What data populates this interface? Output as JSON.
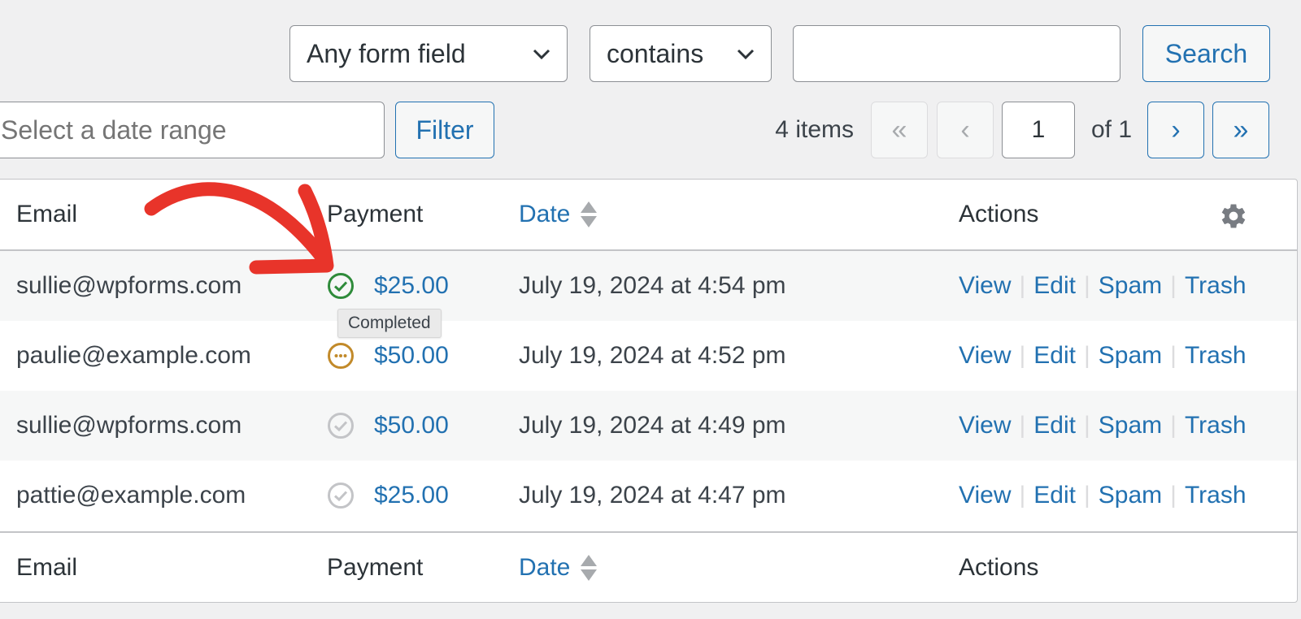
{
  "search": {
    "field_select": "Any form field",
    "operator_select": "contains",
    "query_value": "",
    "search_label": "Search"
  },
  "filter": {
    "date_placeholder": "Select a date range",
    "filter_label": "Filter"
  },
  "pagination": {
    "items_count": "4 items",
    "first": "«",
    "prev": "‹",
    "current_page": "1",
    "of_total": "of 1",
    "next": "›",
    "last": "»"
  },
  "table": {
    "columns": {
      "email": "Email",
      "payment": "Payment",
      "date": "Date",
      "actions": "Actions"
    },
    "rows": [
      {
        "email": "sullie@wpforms.com",
        "payment_status": "completed",
        "amount": "$25.00",
        "date": "July 19, 2024 at 4:54 pm"
      },
      {
        "email": "paulie@example.com",
        "payment_status": "pending",
        "amount": "$50.00",
        "date": "July 19, 2024 at 4:52 pm"
      },
      {
        "email": "sullie@wpforms.com",
        "payment_status": "none",
        "amount": "$50.00",
        "date": "July 19, 2024 at 4:49 pm"
      },
      {
        "email": "pattie@example.com",
        "payment_status": "none",
        "amount": "$25.00",
        "date": "July 19, 2024 at 4:47 pm"
      }
    ],
    "actions": {
      "view": "View",
      "edit": "Edit",
      "spam": "Spam",
      "trash": "Trash",
      "separator": "|"
    }
  },
  "tooltip": {
    "text": "Completed"
  },
  "colors": {
    "accent": "#2271b1",
    "completed": "#2e8b3a",
    "pending": "#c28a2a",
    "inactive": "#c3c4c7",
    "annotation_arrow": "#e8342a"
  }
}
